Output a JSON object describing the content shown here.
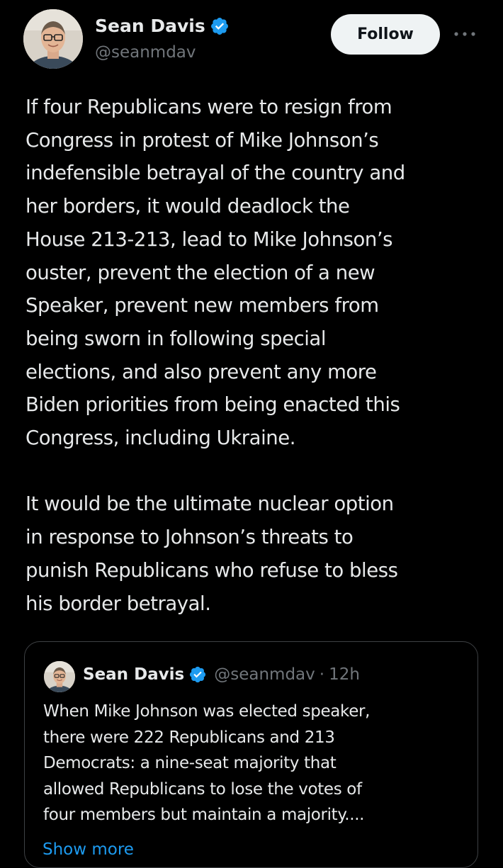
{
  "author": {
    "display_name": "Sean Davis",
    "handle": "@seanmdav",
    "verified": true,
    "verified_color": "#1d9bf0",
    "avatar_icon": "profile-photo"
  },
  "actions": {
    "follow_label": "Follow",
    "more_icon": "more-horizontal-icon"
  },
  "tweet": {
    "paragraphs": [
      {
        "lines": [
          "If four Republicans were to resign from",
          "Congress in protest of Mike Johnson’s",
          "indefensible betrayal of the country and",
          "her borders, it would deadlock the",
          "House 213-213, lead to Mike Johnson’s",
          "ouster, prevent the election of a new",
          "Speaker, prevent new members from",
          "being sworn in following special",
          "elections, and also prevent any more",
          "Biden priorities from being enacted this",
          "Congress, including Ukraine."
        ]
      },
      {
        "lines": [
          "It would be the ultimate nuclear option",
          "in response to Johnson’s threats to",
          "punish Republicans who refuse to bless",
          "his border betrayal."
        ]
      }
    ]
  },
  "quoted_tweet": {
    "display_name": "Sean Davis",
    "handle": "@seanmdav",
    "separator": "·",
    "time": "12h",
    "lines": [
      "When Mike Johnson was elected speaker,",
      "there were 222 Republicans and 213",
      "Democrats: a nine-seat majority that",
      "allowed Republicans to lose the votes of",
      "four members but maintain a majority...."
    ],
    "show_more_label": "Show more",
    "show_more_color": "#1d9bf0"
  },
  "colors": {
    "background": "#000000",
    "text_primary": "#e7e9ea",
    "text_secondary": "#71767b",
    "border": "#3e4144",
    "follow_bg": "#eff3f4"
  }
}
